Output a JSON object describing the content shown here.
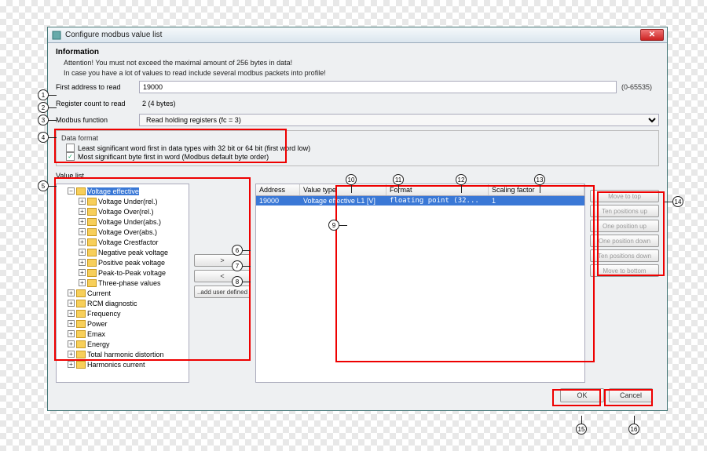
{
  "window": {
    "title": "Configure modbus value list"
  },
  "info": {
    "heading": "Information",
    "line1": "Attention! You must not exceed the maximal amount of 256 bytes in data!",
    "line2": "In case you have a lot of values to read include several modbus packets into profile!"
  },
  "fields": {
    "first_address_label": "First address to read",
    "first_address_value": "19000",
    "first_address_range": "(0-65535)",
    "reg_count_label": "Register count to read",
    "reg_count_value": "2 (4 bytes)",
    "modbus_fn_label": "Modbus function",
    "modbus_fn_value": "Read holding registers (fc = 3)"
  },
  "data_format": {
    "legend": "Data format",
    "cb1_label": "Least significant word first in data types with 32 bit or 64 bit (first word low)",
    "cb1_checked": false,
    "cb2_label": "Most significant byte first in word (Modbus default byte order)",
    "cb2_checked": true
  },
  "value_list_label": "Value list",
  "tree": {
    "selected": "Voltage effective",
    "sub": [
      "Voltage Under(rel.)",
      "Voltage Over(rel.)",
      "Voltage Under(abs.)",
      "Voltage Over(abs.)",
      "Voltage Crestfactor",
      "Negative peak voltage",
      "Positive peak voltage",
      "Peak-to-Peak voltage",
      "Three-phase values"
    ],
    "top": [
      "Current",
      "RCM diagnostic",
      "Frequency",
      "Power",
      "Emax",
      "Energy",
      "Total harmonic distortion",
      "Harmonics current"
    ]
  },
  "mid_buttons": {
    "add": ">",
    "remove": "<",
    "add_user": "..add user defined"
  },
  "table": {
    "headers": {
      "address": "Address",
      "value_type": "Value type",
      "format": "Format",
      "scaling": "Scaling factor"
    },
    "row": {
      "address": "19000",
      "value_type": "Voltage effective L1 [V]",
      "format": "floating point (32...",
      "scaling": "1"
    }
  },
  "right_buttons": [
    "Move to top",
    "Ten positions up",
    "One position up",
    "One position down",
    "Ten positions down",
    "Move to bottom"
  ],
  "footer": {
    "ok": "OK",
    "cancel": "Cancel"
  },
  "callouts": [
    "1",
    "2",
    "3",
    "4",
    "5",
    "6",
    "7",
    "8",
    "9",
    "10",
    "11",
    "12",
    "13",
    "14",
    "15",
    "16"
  ]
}
